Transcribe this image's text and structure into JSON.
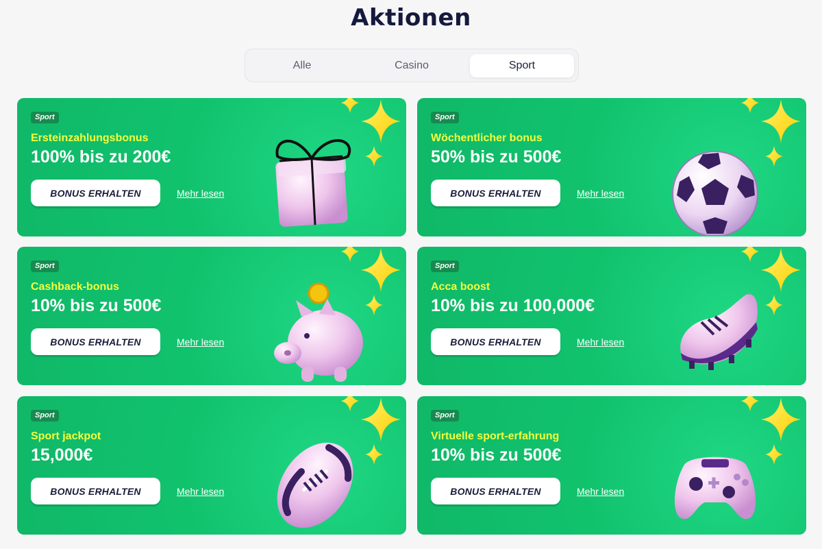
{
  "page": {
    "title": "Aktionen"
  },
  "tabs": [
    {
      "label": "Alle",
      "active": false
    },
    {
      "label": "Casino",
      "active": false
    },
    {
      "label": "Sport",
      "active": true
    }
  ],
  "cards": [
    {
      "badge": "Sport",
      "label": "Ersteinzahlungsbonus",
      "amount": "100% bis zu 200€",
      "button": "BONUS ERHALTEN",
      "link": "Mehr lesen",
      "icon": "gift-box-icon"
    },
    {
      "badge": "Sport",
      "label": "Wöchentlicher bonus",
      "amount": "50% bis zu 500€",
      "button": "BONUS ERHALTEN",
      "link": "Mehr lesen",
      "icon": "soccer-ball-icon"
    },
    {
      "badge": "Sport",
      "label": "Cashback-bonus",
      "amount": "10% bis zu 500€",
      "button": "BONUS ERHALTEN",
      "link": "Mehr lesen",
      "icon": "piggy-bank-icon"
    },
    {
      "badge": "Sport",
      "label": "Acca boost",
      "amount": "10% bis zu 100,000€",
      "button": "BONUS ERHALTEN",
      "link": "Mehr lesen",
      "icon": "football-boot-icon"
    },
    {
      "badge": "Sport",
      "label": "Sport jackpot",
      "amount": "15,000€",
      "button": "BONUS ERHALTEN",
      "link": "Mehr lesen",
      "icon": "american-football-icon"
    },
    {
      "badge": "Sport",
      "label": "Virtuelle sport-erfahrung",
      "amount": "10% bis zu 500€",
      "button": "BONUS ERHALTEN",
      "link": "Mehr lesen",
      "icon": "gamepad-icon"
    }
  ],
  "colors": {
    "card_green": "#11c26d",
    "label_yellow": "#f3ff3d",
    "title_navy": "#151a3d",
    "star_yellow": "#ffe11a",
    "object_pink": "#f0c8ec"
  }
}
